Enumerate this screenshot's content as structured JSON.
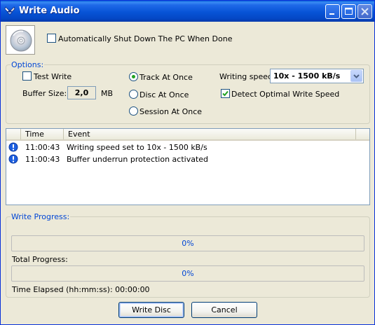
{
  "window": {
    "title": "Write Audio"
  },
  "top": {
    "shutdown_label": "Automatically Shut Down The PC When Done",
    "shutdown_checked": false
  },
  "options": {
    "group_title": "Options:",
    "test_write_label": "Test Write",
    "test_write_checked": false,
    "buffer_label": "Buffer Size:",
    "buffer_value": "2,0",
    "buffer_unit": "MB",
    "mode_track": "Track At Once",
    "mode_disc": "Disc At Once",
    "mode_session": "Session At Once",
    "selected_mode": "Track At Once",
    "speed_label": "Writing speed:",
    "speed_value": "10x - 1500 kB/s",
    "detect_label": "Detect Optimal Write Speed",
    "detect_checked": true
  },
  "events": {
    "columns": [
      "Time",
      "Event"
    ],
    "rows": [
      {
        "time": "11:00:43",
        "event": "Writing speed set to 10x - 1500 kB/s",
        "icon": "info-icon"
      },
      {
        "time": "11:00:43",
        "event": "Buffer underrun protection activated",
        "icon": "info-icon"
      }
    ]
  },
  "progress": {
    "group_title": "Write Progress:",
    "write_percent": "0%",
    "total_label": "Total Progress:",
    "total_percent": "0%",
    "elapsed": "Time Elapsed (hh:mm:ss): 00:00:00"
  },
  "buttons": {
    "write": "Write Disc",
    "cancel": "Cancel"
  },
  "colors": {
    "titlebar": "#0753d6",
    "face": "#ece9d8",
    "group_title": "#0046d5",
    "radio_dot": "#21a121"
  }
}
